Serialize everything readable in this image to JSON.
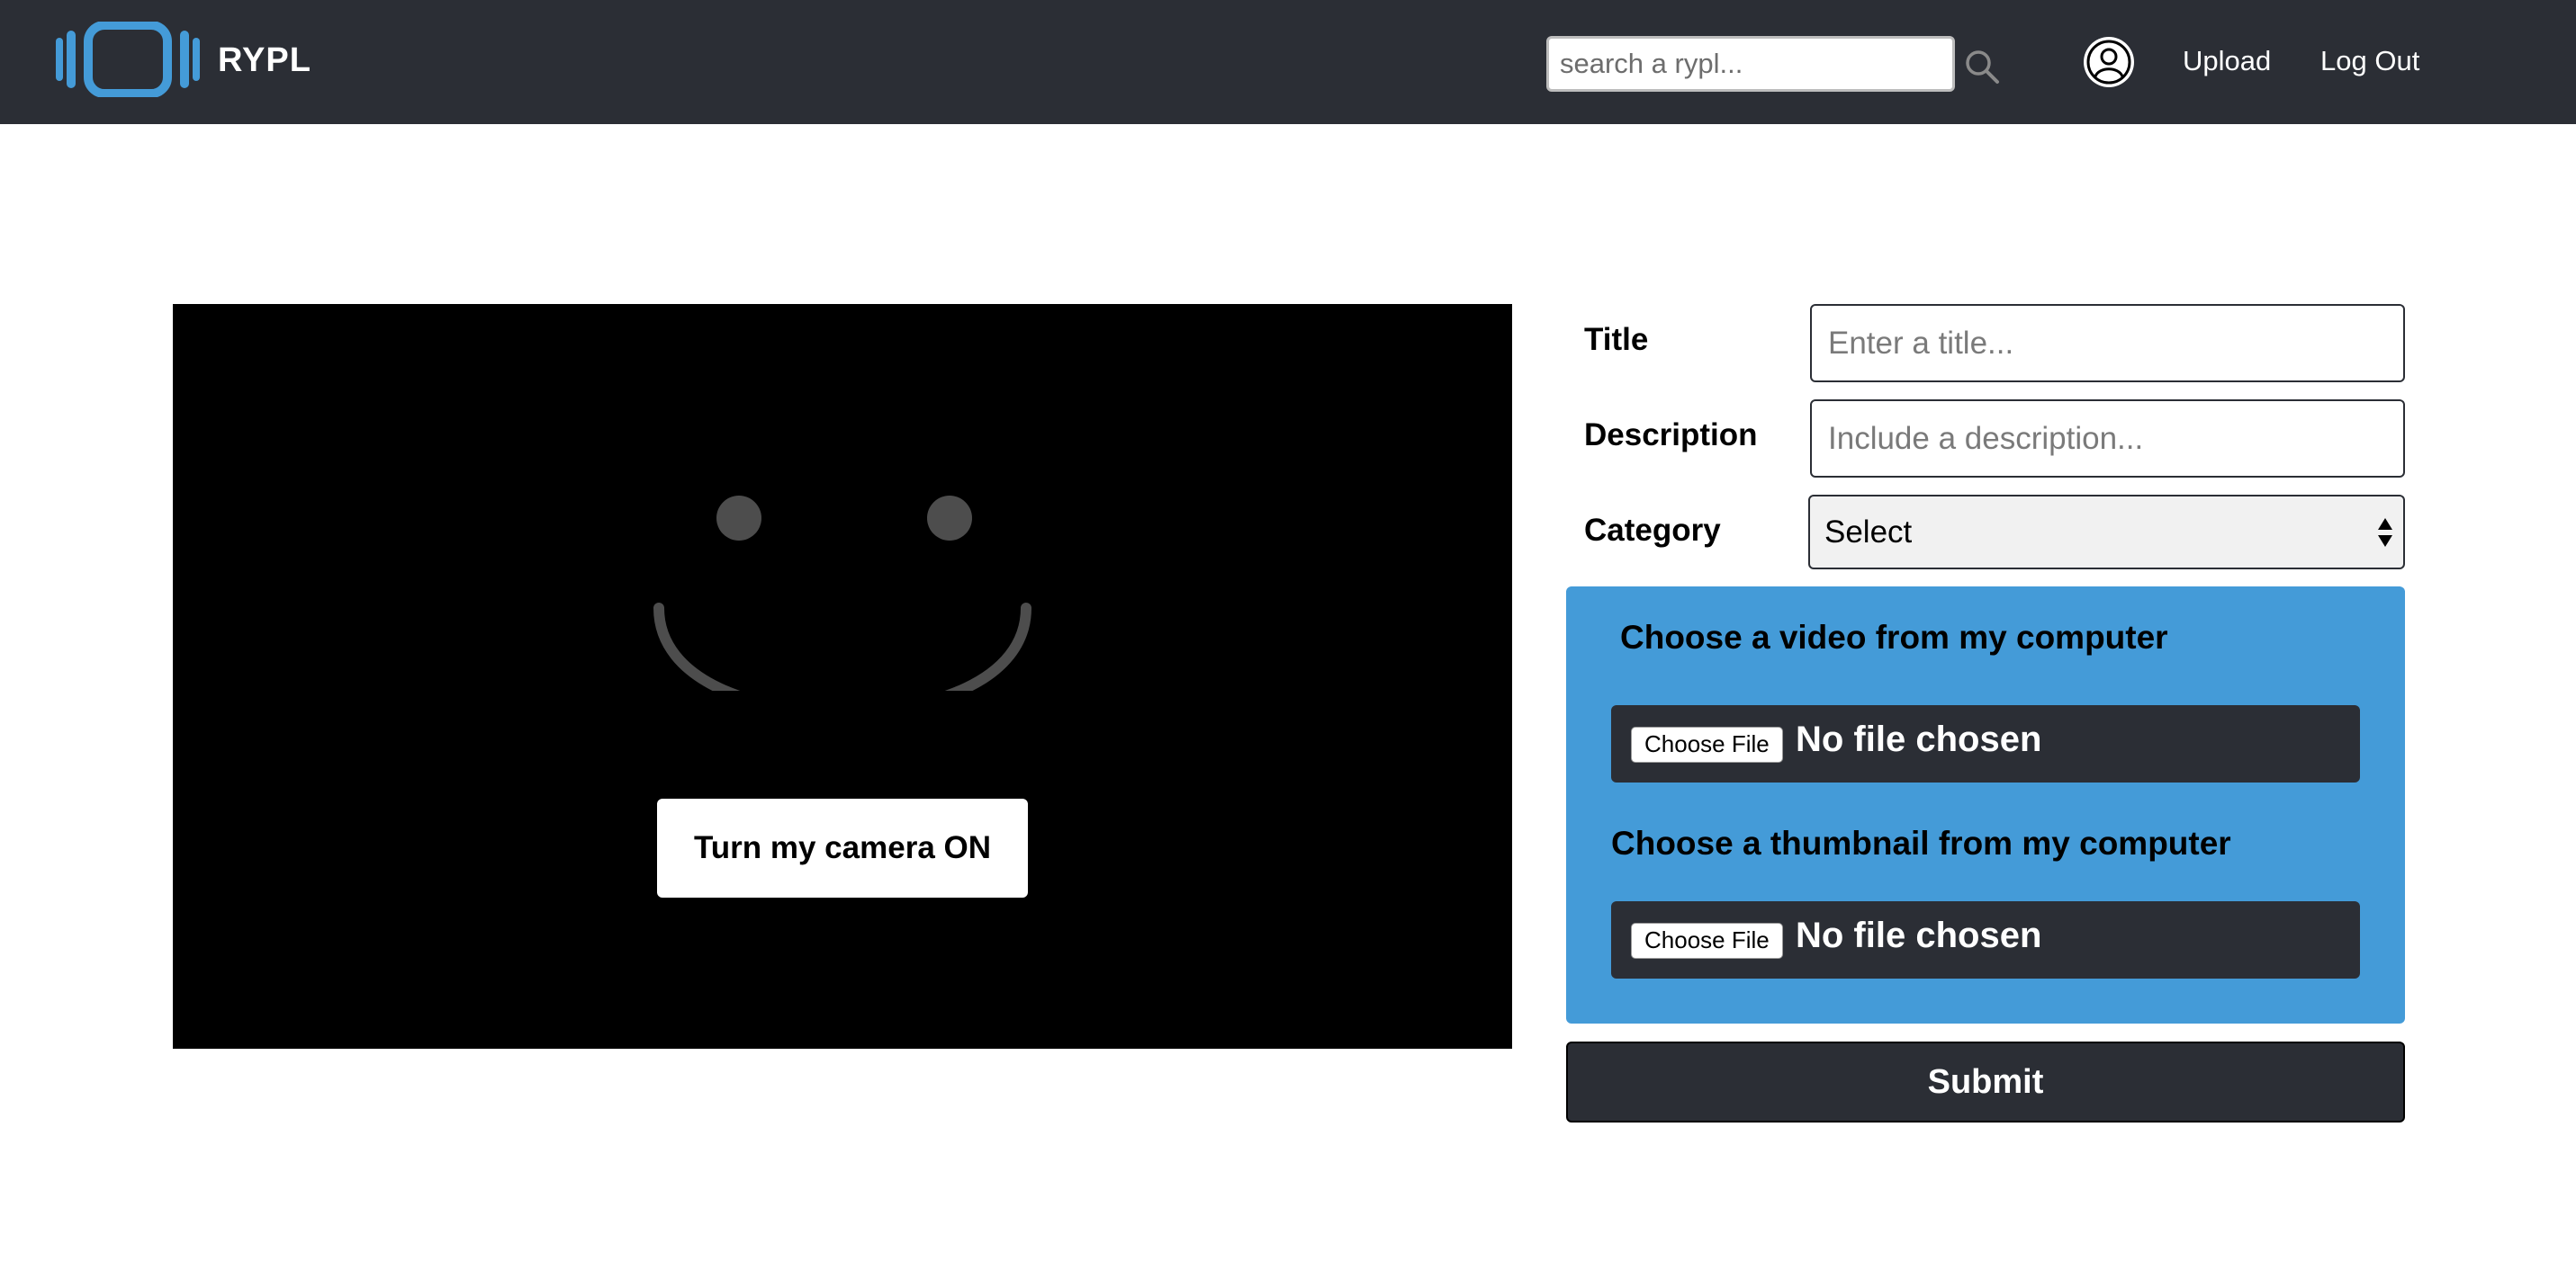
{
  "header": {
    "brand": "RYPL",
    "logo_icon": "rypl-logo",
    "search": {
      "placeholder": "search a rypl...",
      "value": "",
      "icon": "search-icon"
    },
    "avatar_icon": "user-circle-icon",
    "links": {
      "upload": "Upload",
      "logout": "Log Out"
    }
  },
  "camera": {
    "placeholder_icon": "smiley-face-icon",
    "button_label": "Turn my camera ON"
  },
  "form": {
    "title": {
      "label": "Title",
      "placeholder": "Enter a title...",
      "value": ""
    },
    "description": {
      "label": "Description",
      "placeholder": "Include a description...",
      "value": ""
    },
    "category": {
      "label": "Category",
      "selected": "Select"
    },
    "video_upload": {
      "heading": "Choose a video from my computer",
      "button_label": "Choose File",
      "status": "No file chosen"
    },
    "thumbnail_upload": {
      "heading": "Choose a thumbnail from my computer",
      "button_label": "Choose File",
      "status": "No file chosen"
    },
    "submit_label": "Submit"
  },
  "colors": {
    "nav_bg": "#2b2e35",
    "accent_blue": "#449bd8",
    "camera_bg": "#000000",
    "smiley": "#4d4d4d"
  }
}
